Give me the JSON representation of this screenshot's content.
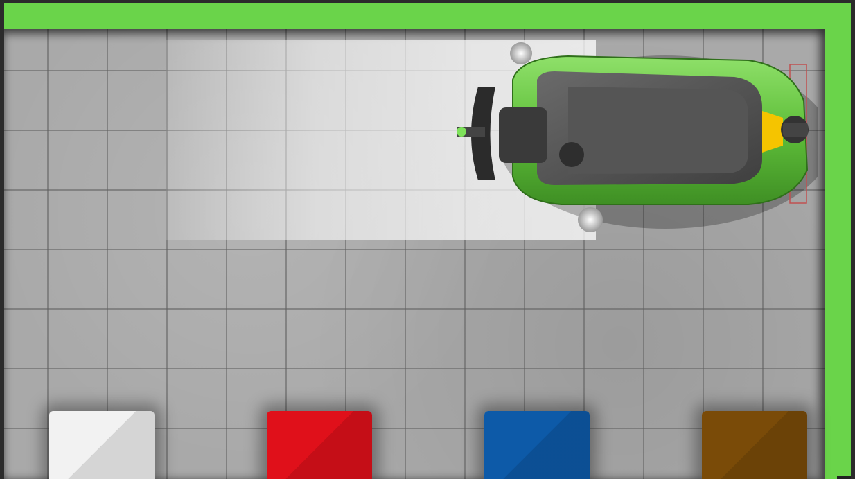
{
  "scene": {
    "wall_color": "#6ad44a",
    "floor_color": "#a9a9a9",
    "cleaned_area_color": "#f2f2f2"
  },
  "machine": {
    "name": "floor-scrubber",
    "body_color": "#5fbf3a",
    "seat_color": "#5a5a5a",
    "indicator_color": "#f5c400"
  },
  "bins": [
    {
      "color": "#f2f2f2",
      "icon": "white-bin"
    },
    {
      "color": "#e0101a",
      "icon": "red-bin"
    },
    {
      "color": "#0d5aa8",
      "icon": "blue-bin"
    },
    {
      "color": "#7a4b08",
      "icon": "brown-bin"
    }
  ]
}
